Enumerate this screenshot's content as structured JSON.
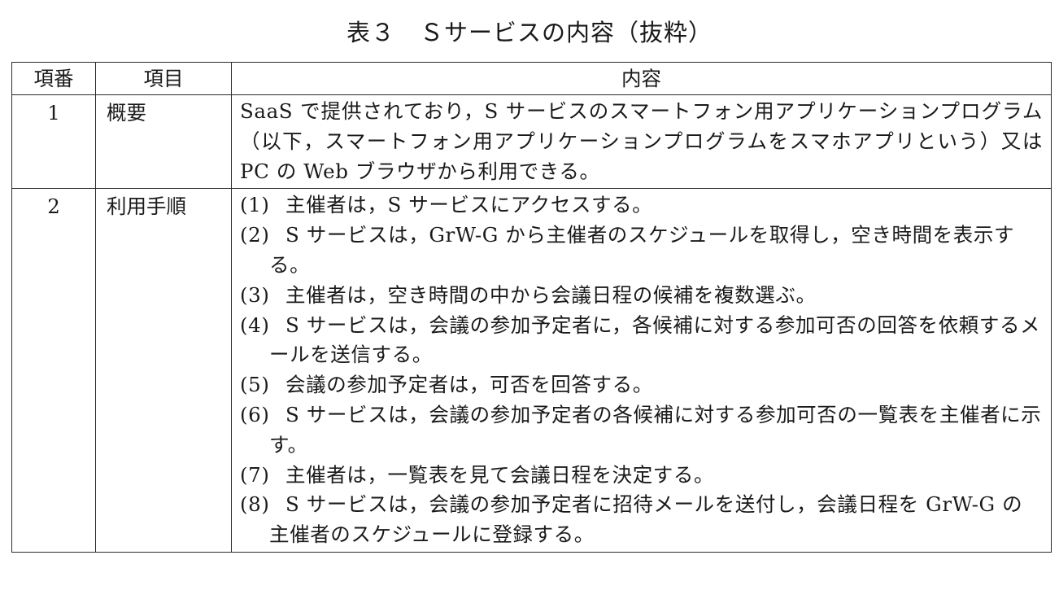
{
  "caption": "表３　Ｓサービスの内容（抜粋）",
  "table": {
    "headers": {
      "no": "項番",
      "item": "項目",
      "content": "内容"
    },
    "rows": [
      {
        "no": "1",
        "item": "概要",
        "content": "SaaS で提供されており，S サービスのスマートフォン用アプリケーションプログラム（以下，スマートフォン用アプリケーションプログラムをスマホアプリという）又は PC の Web ブラウザから利用できる。"
      },
      {
        "no": "2",
        "item": "利用手順",
        "steps": [
          {
            "num": "(1)",
            "text": "主催者は，S サービスにアクセスする。"
          },
          {
            "num": "(2)",
            "text": "S サービスは，GrW-G から主催者のスケジュールを取得し，空き時間を表示する。"
          },
          {
            "num": "(3)",
            "text": "主催者は，空き時間の中から会議日程の候補を複数選ぶ。"
          },
          {
            "num": "(4)",
            "text": "S サービスは，会議の参加予定者に，各候補に対する参加可否の回答を依頼するメールを送信する。"
          },
          {
            "num": "(5)",
            "text": "会議の参加予定者は，可否を回答する。"
          },
          {
            "num": "(6)",
            "text": "S サービスは，会議の参加予定者の各候補に対する参加可否の一覧表を主催者に示す。"
          },
          {
            "num": "(7)",
            "text": "主催者は，一覧表を見て会議日程を決定する。"
          },
          {
            "num": "(8)",
            "text": "S サービスは，会議の参加予定者に招待メールを送付し，会議日程を GrW-G の主催者のスケジュールに登録する。"
          }
        ]
      }
    ]
  }
}
